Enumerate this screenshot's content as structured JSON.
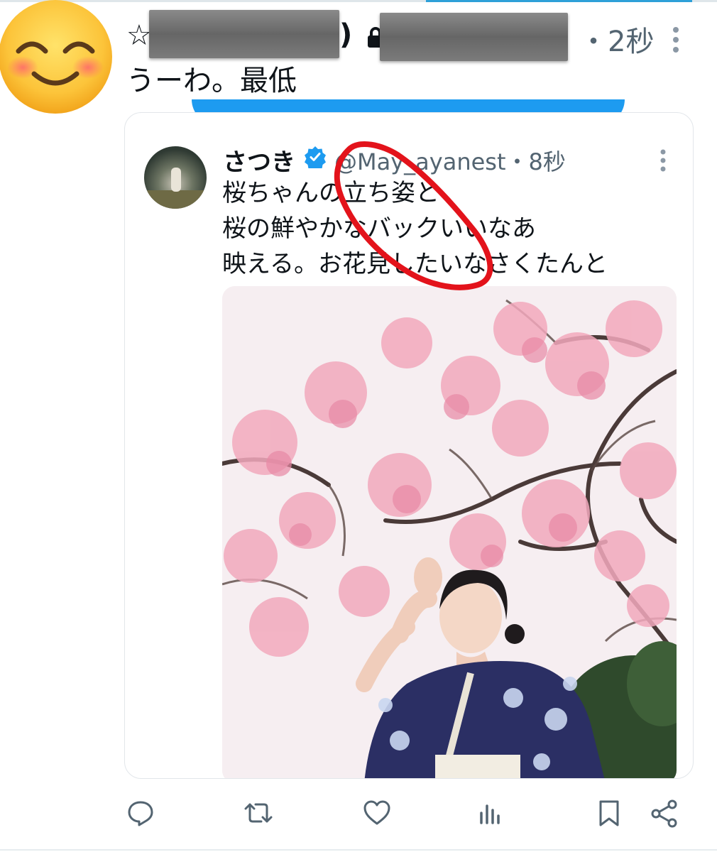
{
  "header": {
    "star": "☆",
    "paren": ")",
    "time": "・2秒"
  },
  "tweet": {
    "text": "うーわ。最低"
  },
  "quoted": {
    "name": "さつき",
    "handle": "@May_ayanest・8秒",
    "lines": [
      "桜ちゃんの立ち姿と",
      "桜の鮮やかなバックいいなあ",
      "映える。お花見したいなさくたんと"
    ]
  },
  "actions": [
    "reply-icon",
    "retweet-icon",
    "like-icon",
    "views-icon",
    "bookmark-icon",
    "share-icon"
  ],
  "colors": {
    "accent": "#1d9bf0",
    "annotation": "#e3131b",
    "muted": "#536471"
  }
}
